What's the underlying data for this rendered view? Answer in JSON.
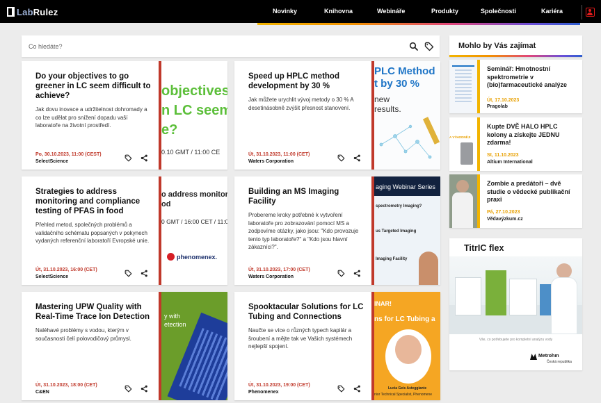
{
  "brand": {
    "name_part1": "Lab",
    "name_part2": "Rulez"
  },
  "nav": {
    "items": [
      {
        "label": "Novinky"
      },
      {
        "label": "Knihovna"
      },
      {
        "label": "Webináře"
      },
      {
        "label": "Produkty"
      },
      {
        "label": "Společnosti"
      },
      {
        "label": "Kariéra"
      }
    ]
  },
  "search": {
    "placeholder": "Co hledáte?"
  },
  "cards": [
    {
      "title": "Do your objectives to go greener in LC seem difficult to achieve?",
      "description": "Jak dovu inovace a udržitelnost dohromady a co lze udělat pro snížení dopadu vaší laboratoře na životní prostředí.",
      "date": "Po, 30.10.2023, 11:00 (CEST)",
      "org": "SelectScience",
      "img_line1": "objectives",
      "img_line2": "n LC seem",
      "img_line3": "e?",
      "img_line4": "0.10 GMT / 11:00 CE"
    },
    {
      "title": "Speed up HPLC method development by 30 %",
      "description": "Jak můžete urychlit vývoj metody o 30 % A desetinásobně zvýšit přesnost stanovení.",
      "date": "Út, 31.10.2023, 11:00 (CET)",
      "org": "Waters Corporation",
      "img_line1": "PLC Method",
      "img_line2": "t by 30 %",
      "img_line3": "new",
      "img_line4": "results."
    },
    {
      "title": "Strategies to address monitoring and compliance testing of PFAS in food",
      "description": "Přehled metod, společných problémů a validačního schématu popsaných v pokynech vydaných referenční laboratoří Evropské unie.",
      "date": "Út, 31.10.2023, 16:00 (CET)",
      "org": "SelectScience",
      "img_line1": "o address monitor",
      "img_line2": "od",
      "img_line3": "0 GMT / 16:00 CET / 11:0",
      "img_line4": "phenomenex."
    },
    {
      "title": "Building an MS Imaging Facility",
      "description": "Probereme kroky potřebné k vytvoření laboratoře pro zobrazování pomocí MS a zodpovíme otázky, jako jsou: \"Kdo provozuje tento typ laboratoře?\" a \"Kdo jsou hlavní zákazníci?\".",
      "date": "Út, 31.10.2023, 17:00 (CET)",
      "org": "Waters Corporation",
      "img_line1": "aging Webinar Series",
      "img_line2": "spectrometry Imaging?",
      "img_line3": "us Targeted Imaging",
      "img_line4": "Imaging Facility"
    },
    {
      "title": "Mastering UPW Quality with Real-Time Trace Ion Detection",
      "description": "Naléhavé problémy s vodou, kterým v současnosti čelí polovodičový průmysl.",
      "date": "Út, 31.10.2023, 18:00 (CET)",
      "org": "C&EN",
      "img_line1": "y with",
      "img_line2": "etection",
      "img_line3": "",
      "img_line4": ""
    },
    {
      "title": "Spooktacular Solutions for LC Tubing and Connections",
      "description": "Naučte se více o různých typech kapilár a šroubení a mějte tak ve Vašich systémech nejlepší spojení.",
      "date": "Út, 31.10.2023, 19:00 (CET)",
      "org": "Phenomenex",
      "img_line1": "INAR!",
      "img_line2": "ns for LC Tubing a",
      "img_line3": "Lucia Geis Asteggiante",
      "img_line4": "nior Technical Specialist, Phenomene"
    }
  ],
  "sidebar": {
    "title": "Mohlo by Vás zajímat",
    "items": [
      {
        "title": "Seminář: Hmotnostní spektrometrie v (bio)farmaceutické analýze",
        "date": "Út, 17.10.2023",
        "org": "Pragolab"
      },
      {
        "title": "Kupte DVĚ HALO HPLC kolony a získejte JEDNU zdarma!",
        "date": "St, 11.10.2023",
        "org": "Altium International",
        "thumb_text": "A VÝHODNĚJI"
      },
      {
        "title": "Zombie a predátoři – dvě studie o vědecké publikační praxi",
        "date": "Pá, 27.10.2023",
        "org": "Vědavýzkum.cz"
      }
    ]
  },
  "ad": {
    "title": "TitrIC flex",
    "caption": "Vše, co potřebujete pro kompletní analýzu vody",
    "brand": "Metrohm",
    "brand_sub": "Česká republika"
  },
  "colors": {
    "accent_red": "#c0392b",
    "accent_yellow": "#f2b400",
    "topbar": "#000000"
  }
}
